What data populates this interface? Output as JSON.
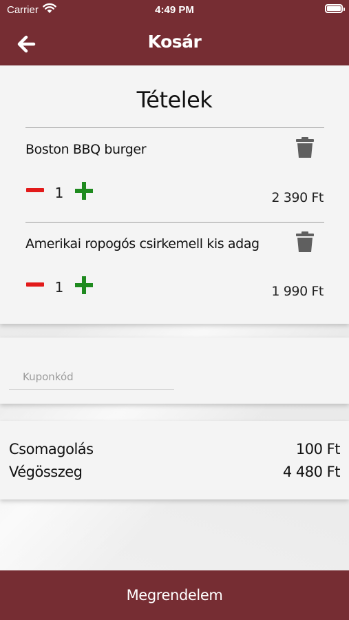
{
  "status_bar": {
    "carrier": "Carrier",
    "time": "4:49 PM"
  },
  "header": {
    "title": "Kosár",
    "back_icon": "arrow-left-icon"
  },
  "cart": {
    "section_title": "Tételek",
    "items": [
      {
        "name": "Boston BBQ burger",
        "quantity": "1",
        "price": "2 390 Ft"
      },
      {
        "name": "Amerikai ropogós csirkemell kis adag",
        "quantity": "1",
        "price": "1 990 Ft"
      }
    ]
  },
  "coupon": {
    "placeholder": "Kuponkód",
    "value": ""
  },
  "summary": {
    "packaging_label": "Csomagolás",
    "packaging_value": "100 Ft",
    "total_label": "Végösszeg",
    "total_value": "4 480 Ft"
  },
  "footer": {
    "order_button": "Megrendelem"
  },
  "colors": {
    "brand": "#762d33",
    "minus": "#e21a1a",
    "plus": "#1f8a1f",
    "trash": "#5f5f5f"
  }
}
